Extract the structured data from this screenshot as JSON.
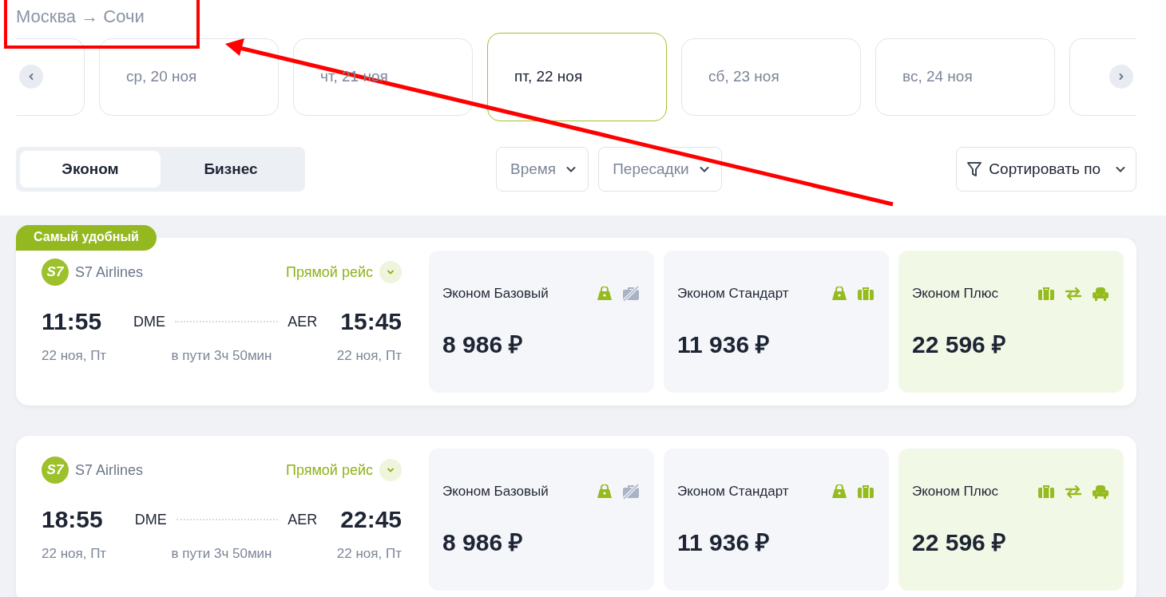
{
  "route": {
    "from": "Москва",
    "arrow": "→",
    "to": "Сочи"
  },
  "dates": [
    {
      "label": "ср, 20 ноя",
      "selected": false
    },
    {
      "label": "чт, 21 ноя",
      "selected": false
    },
    {
      "label": "пт, 22 ноя",
      "selected": true
    },
    {
      "label": "сб, 23 ноя",
      "selected": false
    },
    {
      "label": "вс, 24 ноя",
      "selected": false
    }
  ],
  "cabin_tabs": [
    {
      "label": "Эконом",
      "selected": true
    },
    {
      "label": "Бизнес",
      "selected": false
    }
  ],
  "filters": [
    {
      "label": "Время"
    },
    {
      "label": "Пересадки"
    }
  ],
  "sort": {
    "label": "Сортировать по"
  },
  "flights": [
    {
      "badge": "Самый удобный",
      "logo": "S7",
      "airline": "S7 Airlines",
      "type": "Прямой рейс",
      "dep_time": "11:55",
      "dep_airport": "DME",
      "arr_airport": "AER",
      "arr_time": "15:45",
      "dep_date": "22 ноя, Пт",
      "duration": "в пути 3ч 50мин",
      "arr_date": "22 ноя, Пт",
      "fares": [
        {
          "name": "Эконом Базовый",
          "price": "8 986 ₽",
          "highlighted": false,
          "icons": [
            {
              "kind": "bag"
            },
            {
              "kind": "no_luggage"
            }
          ]
        },
        {
          "name": "Эконом Стандарт",
          "price": "11 936 ₽",
          "highlighted": false,
          "icons": [
            {
              "kind": "bag"
            },
            {
              "kind": "luggage"
            }
          ]
        },
        {
          "name": "Эконом Плюс",
          "price": "22 596 ₽",
          "highlighted": true,
          "icons": [
            {
              "kind": "luggage"
            },
            {
              "kind": "exchange"
            },
            {
              "kind": "seat"
            }
          ]
        }
      ]
    },
    {
      "logo": "S7",
      "airline": "S7 Airlines",
      "type": "Прямой рейс",
      "dep_time": "18:55",
      "dep_airport": "DME",
      "arr_airport": "AER",
      "arr_time": "22:45",
      "dep_date": "22 ноя, Пт",
      "duration": "в пути 3ч 50мин",
      "arr_date": "22 ноя, Пт",
      "fares": [
        {
          "name": "Эконом Базовый",
          "price": "8 986 ₽",
          "highlighted": false,
          "icons": [
            {
              "kind": "bag"
            },
            {
              "kind": "no_luggage"
            }
          ]
        },
        {
          "name": "Эконом Стандарт",
          "price": "11 936 ₽",
          "highlighted": false,
          "icons": [
            {
              "kind": "bag"
            },
            {
              "kind": "luggage"
            }
          ]
        },
        {
          "name": "Эконом Плюс",
          "price": "22 596 ₽",
          "highlighted": true,
          "icons": [
            {
              "kind": "luggage"
            },
            {
              "kind": "exchange"
            },
            {
              "kind": "seat"
            }
          ]
        }
      ]
    }
  ]
}
